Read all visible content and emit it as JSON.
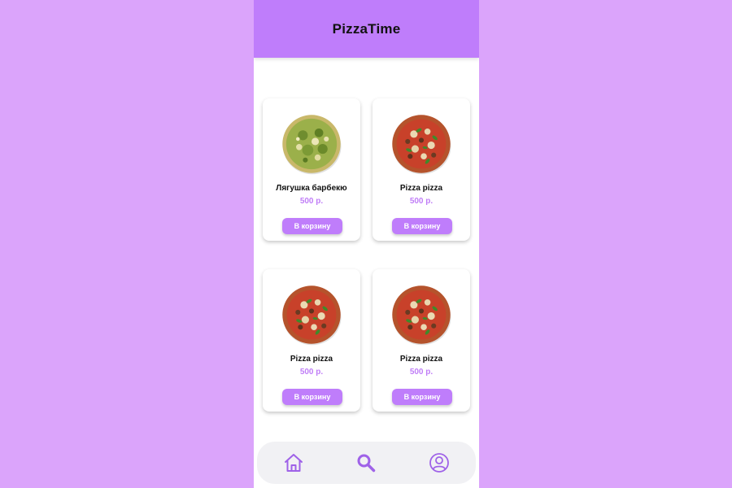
{
  "app": {
    "title": "PizzaTime"
  },
  "products": [
    {
      "name": "Лягушка барбекю",
      "price": "500 р.",
      "button_label": "В корзину",
      "image": "green-pesto-pizza"
    },
    {
      "name": "Pizza pizza",
      "price": "500 р.",
      "button_label": "В корзину",
      "image": "meat-pizza"
    },
    {
      "name": "Pizza pizza",
      "price": "500 р.",
      "button_label": "В корзину",
      "image": "meat-pizza"
    },
    {
      "name": "Pizza pizza",
      "price": "500 р.",
      "button_label": "В корзину",
      "image": "meat-pizza"
    }
  ],
  "bottom_nav": {
    "items": [
      {
        "icon": "home-icon"
      },
      {
        "icon": "search-icon"
      },
      {
        "icon": "profile-icon"
      }
    ]
  },
  "colors": {
    "background": "#dba4fb",
    "accent": "#bf7dfb",
    "price": "#c07ef7",
    "nav_bar": "#f1f1f4"
  }
}
